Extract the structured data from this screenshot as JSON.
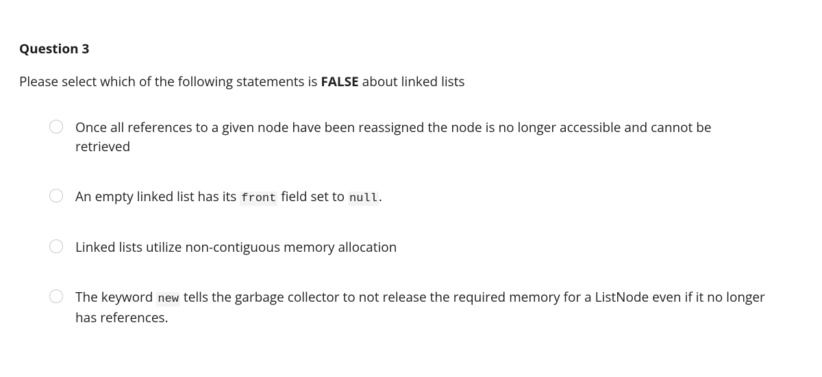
{
  "question": {
    "heading": "Question 3",
    "prompt_pre": "Please select which of the following statements is ",
    "prompt_bold": "FALSE",
    "prompt_post": " about linked lists"
  },
  "options": {
    "a": {
      "text": "Once all references to a given node have been reassigned the node is no longer accessible and cannot be retrieved"
    },
    "b": {
      "pre": "An empty linked list has its ",
      "code1": "front",
      "mid": " field set to ",
      "code2": "null",
      "post": "."
    },
    "c": {
      "text": "Linked lists utilize non-contiguous memory allocation"
    },
    "d": {
      "pre": "The keyword ",
      "code1": "new",
      "post": " tells the garbage collector to not release the required memory for a ListNode even if it no longer has references."
    }
  }
}
